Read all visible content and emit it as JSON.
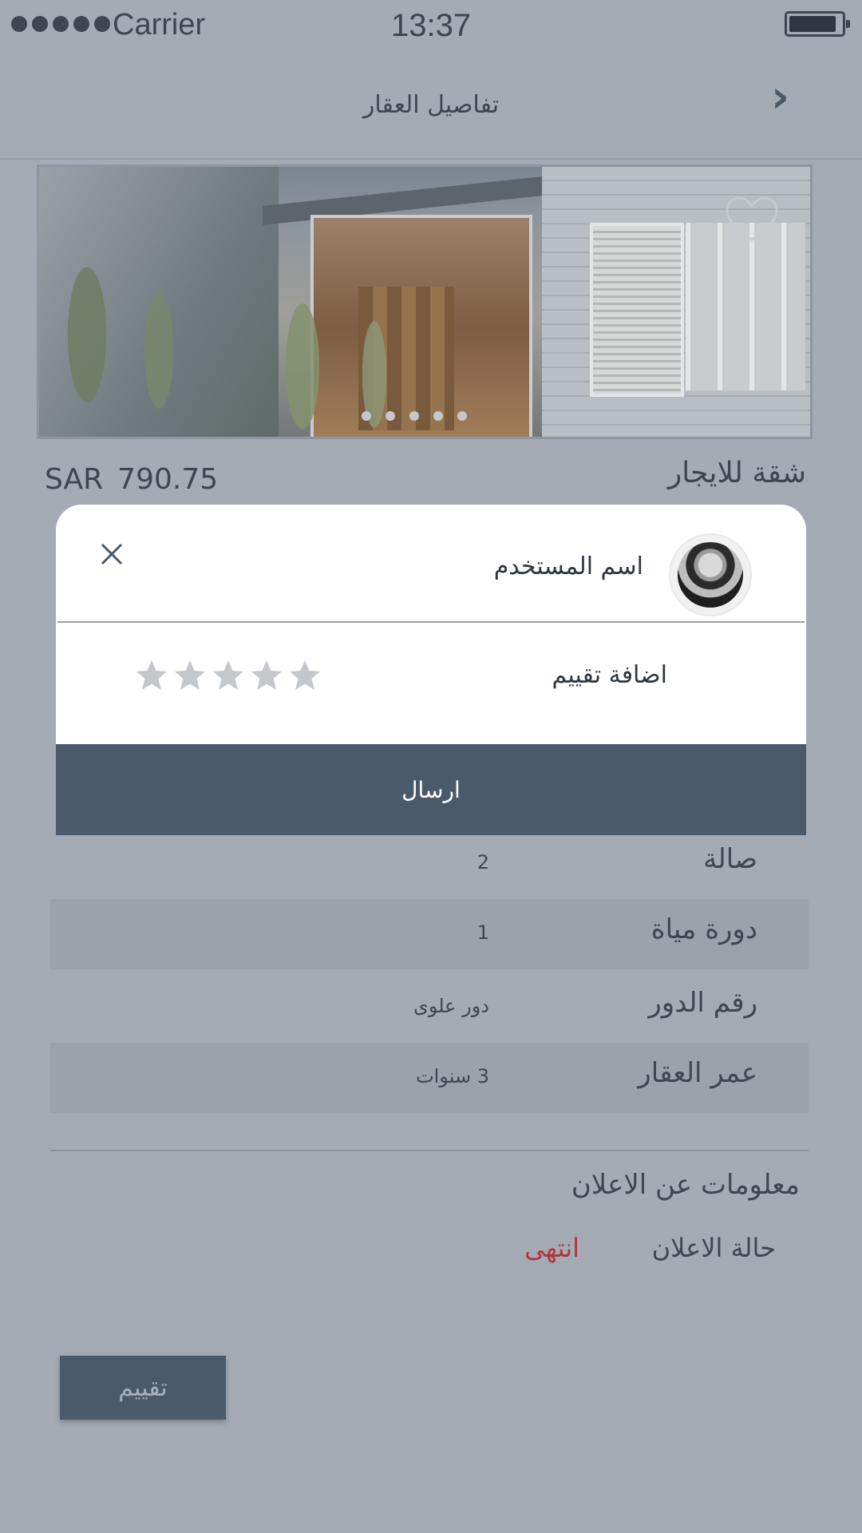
{
  "status_bar": {
    "carrier": "Carrier",
    "time": "13:37",
    "signal_bars": 5
  },
  "nav": {
    "title": "تفاصيل العقار",
    "back_icon": "chevron-icon"
  },
  "carousel": {
    "page_count": 5,
    "favorite_icon": "heart-icon"
  },
  "listing": {
    "currency": "SAR",
    "price": "790.75",
    "title": "شقة للايجار"
  },
  "details": {
    "rows": [
      {
        "label": "صالة",
        "value": "2"
      },
      {
        "label": "دورة مياة",
        "value": "1"
      },
      {
        "label": "رقم الدور",
        "value": "دور علوى"
      },
      {
        "label": "عمر العقار",
        "value": "3   سنوات"
      }
    ]
  },
  "ad_info": {
    "heading": "معلومات عن الاعلان",
    "status_label": "حالة الاعلان",
    "status_value": "انتهى",
    "status_color": "#b2343f"
  },
  "rate_button_label": "تقييم",
  "modal": {
    "username": "اسم المستخدم",
    "rating_label": "اضافة تقييم",
    "rating_value": 0,
    "rating_max": 5,
    "submit_label": "ارسال",
    "close_icon": "close-icon"
  },
  "colors": {
    "primary": "#4a5a6b",
    "overlay_background": "#a4abb4",
    "star_empty": "#c4c7cc"
  }
}
